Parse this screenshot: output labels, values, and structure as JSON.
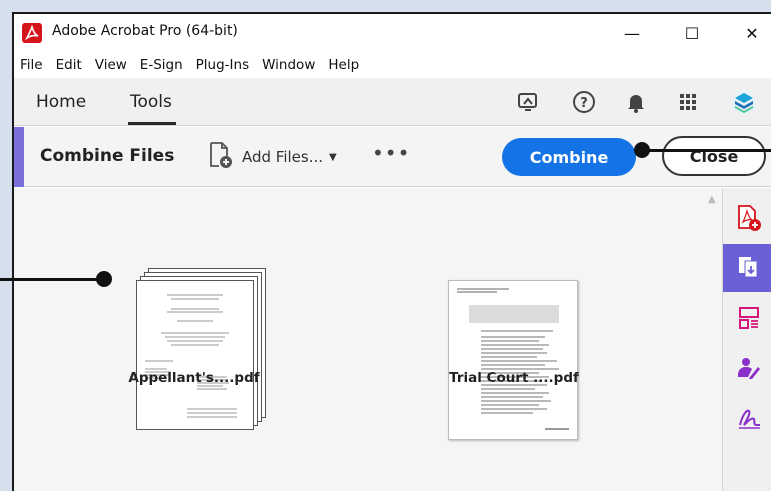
{
  "window": {
    "title": "Adobe Acrobat Pro (64-bit)",
    "controls": {
      "minimize": "—",
      "maximize": "☐",
      "close": "✕"
    }
  },
  "menu": [
    "File",
    "Edit",
    "View",
    "E-Sign",
    "Plug-Ins",
    "Window",
    "Help"
  ],
  "nav": {
    "tabs": [
      "Home",
      "Tools"
    ],
    "active_tab": "Tools",
    "icons": [
      "share-screen-icon",
      "help-icon",
      "notifications-bell-icon",
      "apps-grid-icon",
      "profile-avatar-icon"
    ]
  },
  "toolbar": {
    "title": "Combine Files",
    "add_files_label": "Add Files...",
    "more_label": "•••",
    "combine_label": "Combine",
    "close_label": "Close"
  },
  "files": [
    {
      "name": "Appellant's....pdf"
    },
    {
      "name": "Trial Court ....pdf"
    }
  ],
  "rail": {
    "items": [
      "create-pdf-icon",
      "combine-files-icon",
      "organize-pages-icon",
      "request-signatures-icon",
      "fill-sign-icon"
    ],
    "active": "combine-files-icon"
  },
  "colors": {
    "accent": "#1473e6",
    "tool_accent": "#7b6fd9",
    "acrobat_red": "#d4151b",
    "rail_active": "#6b5fd6"
  }
}
